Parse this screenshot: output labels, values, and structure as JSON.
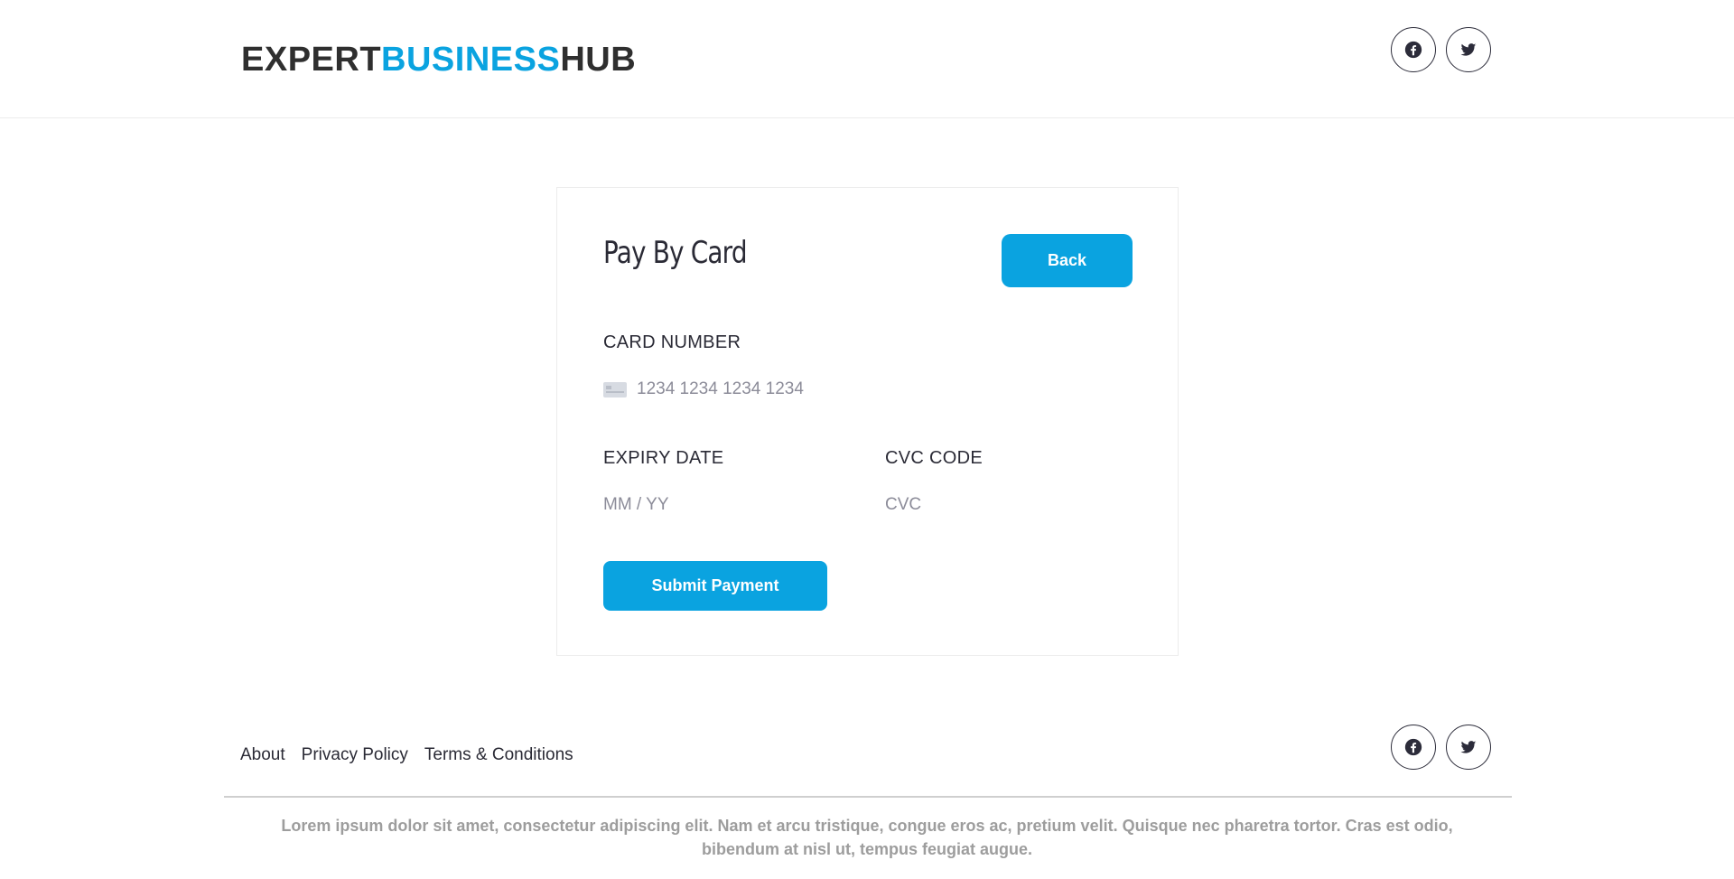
{
  "header": {
    "logo": {
      "part1": "EXPERT",
      "part2": "BUSINESS",
      "part3": "HUB"
    },
    "social": [
      "facebook-icon",
      "twitter-icon"
    ]
  },
  "payment": {
    "title": "Pay By Card",
    "back_label": "Back",
    "card_number_label": "CARD NUMBER",
    "card_number_placeholder": "1234 1234 1234 1234",
    "expiry_label": "EXPIRY DATE",
    "expiry_placeholder": "MM / YY",
    "cvc_label": "CVC CODE",
    "cvc_placeholder": "CVC",
    "submit_label": "Submit Payment"
  },
  "footer": {
    "links": [
      "About",
      "Privacy Policy",
      "Terms & Conditions"
    ],
    "text": "Lorem ipsum dolor sit amet, consectetur adipiscing elit. Nam et arcu tristique, congue eros ac, pretium velit. Quisque nec pharetra tortor. Cras est odio, bibendum at nisl ut, tempus feugiat augue.",
    "social": [
      "facebook-icon",
      "twitter-icon"
    ]
  },
  "colors": {
    "accent": "#0aa3e0",
    "text_dark": "#2a2a35",
    "muted": "#9d9d9d"
  }
}
